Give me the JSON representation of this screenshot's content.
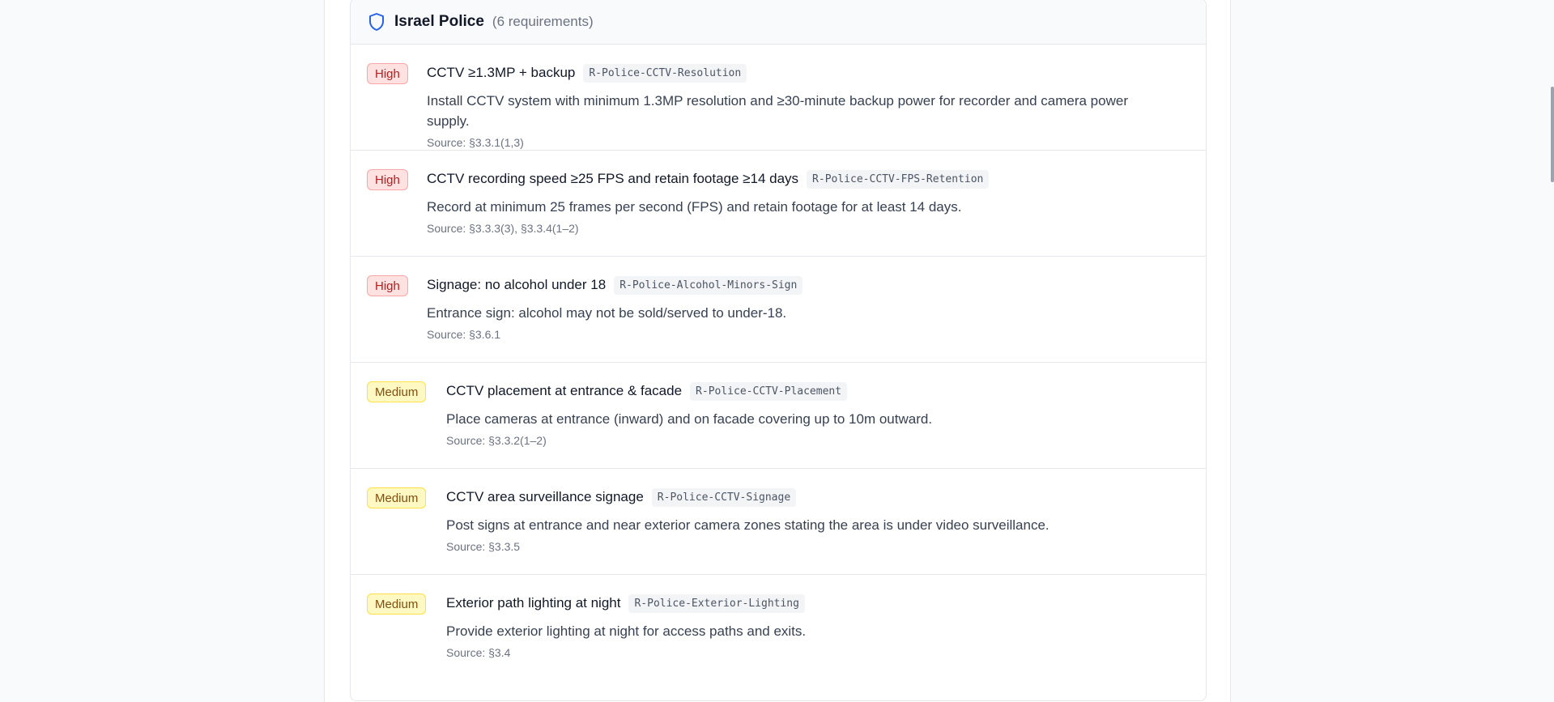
{
  "group": {
    "title": "Israel Police",
    "count": "(6 requirements)",
    "icon": "shield-icon"
  },
  "requirements": [
    {
      "priority": "High",
      "title": "CCTV ≥1.3MP + backup",
      "code": "R-Police-CCTV-Resolution",
      "description": "Install CCTV system with minimum 1.3MP resolution and ≥30-minute backup power for recorder and camera power supply.",
      "source": "Source: §3.3.1(1,3)"
    },
    {
      "priority": "High",
      "title": "CCTV recording speed ≥25 FPS and retain footage ≥14 days",
      "code": "R-Police-CCTV-FPS-Retention",
      "description": "Record at minimum 25 frames per second (FPS) and retain footage for at least 14 days.",
      "source": "Source: §3.3.3(3), §3.3.4(1–2)"
    },
    {
      "priority": "High",
      "title": "Signage: no alcohol under 18",
      "code": "R-Police-Alcohol-Minors-Sign",
      "description": "Entrance sign: alcohol may not be sold/served to under-18.",
      "source": "Source: §3.6.1"
    },
    {
      "priority": "Medium",
      "title": "CCTV placement at entrance & facade",
      "code": "R-Police-CCTV-Placement",
      "description": "Place cameras at entrance (inward) and on facade covering up to 10m outward.",
      "source": "Source: §3.3.2(1–2)"
    },
    {
      "priority": "Medium",
      "title": "CCTV area surveillance signage",
      "code": "R-Police-CCTV-Signage",
      "description": "Post signs at entrance and near exterior camera zones stating the area is under video surveillance.",
      "source": "Source: §3.3.5"
    },
    {
      "priority": "Medium",
      "title": "Exterior path lighting at night",
      "code": "R-Police-Exterior-Lighting",
      "description": "Provide exterior lighting at night for access paths and exits.",
      "source": "Source: §3.4"
    }
  ],
  "colors": {
    "accent": "#2563eb",
    "high_bg": "#fee2e2",
    "high_text": "#b91c1c",
    "medium_bg": "#fef9c3",
    "medium_text": "#854d0e"
  }
}
